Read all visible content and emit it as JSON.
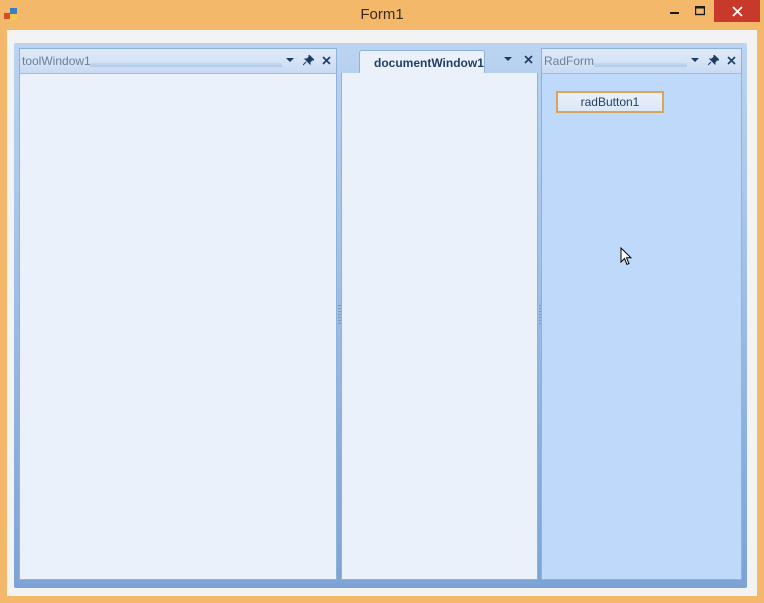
{
  "window": {
    "title": "Form1",
    "accent_color": "#f3b869",
    "close_color": "#c7392b"
  },
  "panels": {
    "tool_window": {
      "title": "toolWindow1"
    },
    "document_window": {
      "tab_label": "documentWindow1"
    },
    "rad_form": {
      "title": "RadForm",
      "button_label": "radButton1"
    }
  },
  "icons": {
    "dropdown": "chevron-down-icon",
    "pin": "pin-icon",
    "close": "close-icon"
  }
}
